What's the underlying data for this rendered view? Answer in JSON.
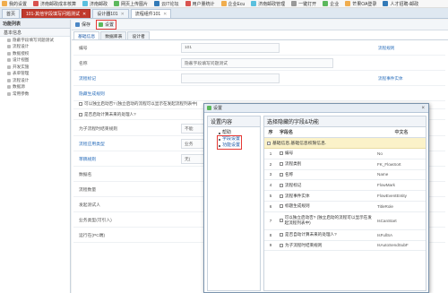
{
  "bookmarks": [
    "我的设置",
    "济南邮政成本核算",
    "济南邮政",
    "网页上传图片",
    "云IT论坛",
    "用户量统计",
    "企业Ecu",
    "济南邮政管理",
    "一键打开",
    "企业",
    "芒果OA登录",
    "人才招聘-邮政"
  ],
  "tabs": [
    {
      "label": "首页"
    },
    {
      "label": "101-其他字段填写问题测试"
    },
    {
      "label": "设计器101"
    },
    {
      "label": "流程组件101"
    }
  ],
  "sidebar": {
    "header": "功能列表",
    "group": "基本信息",
    "items": [
      "隐蔽字段填写问题测试",
      "流程设计",
      "数据授权",
      "设计视图",
      "开发实施",
      "表单管理",
      "流程设计",
      "数据源",
      "常用参数"
    ]
  },
  "toolbar": {
    "save_label": "保存",
    "settings_label": "设置"
  },
  "subtabs": [
    "基础信息",
    "数据库表",
    "设计者"
  ],
  "form": {
    "rows": [
      {
        "label": "编号",
        "value": "101",
        "link": "流程规则"
      },
      {
        "label": "名称",
        "value": "隐蔽字段填写问题测试",
        "link": ""
      },
      {
        "label": "流程标记",
        "value": "",
        "link": "流程事件实体"
      },
      {
        "label": "隐藏生成规则",
        "value": "",
        "link": ""
      },
      {
        "label": "可以独立启动否? (独立启动的流程可以显示在发起流程列表中)",
        "value": "",
        "link": ""
      },
      {
        "label": "是否启动计算未来的处理人?",
        "value": "",
        "link": ""
      },
      {
        "label": "为子流程时结束规则",
        "value": "不能",
        "link": ""
      },
      {
        "label": "流程应用类型",
        "value": "业务",
        "link": ""
      },
      {
        "label": "草稿规则",
        "value": "无(",
        "link": ""
      },
      {
        "label": "数据名",
        "value": "",
        "link": ""
      },
      {
        "label": "流程数量",
        "value": "",
        "link": ""
      },
      {
        "label": "发起测试人",
        "value": "",
        "link": ""
      },
      {
        "label": "业务类型(可引入)",
        "value": "",
        "link": ""
      },
      {
        "label": "运行在(PC端)",
        "value": "",
        "link": ""
      }
    ]
  },
  "dialog": {
    "title": "设置",
    "left_header": "设置内容",
    "tree": [
      "帮助",
      "字段设置",
      "功能设置"
    ],
    "right_header": "选择隐藏的字段&功能",
    "col_no": "序",
    "col_name": "字段名",
    "col_cn": "中文名",
    "note": "基础信息,基础信息权限信息.",
    "rows": [
      {
        "no": "1",
        "name": "编号",
        "cn": "No"
      },
      {
        "no": "2",
        "name": "流程类别",
        "cn": "FK_FlowSort"
      },
      {
        "no": "3",
        "name": "名称",
        "cn": "Name"
      },
      {
        "no": "4",
        "name": "流程标记",
        "cn": "FlowMark"
      },
      {
        "no": "5",
        "name": "流程事件实体",
        "cn": "FlowEventEntity"
      },
      {
        "no": "6",
        "name": "标题生成规则",
        "cn": "TitleRole"
      },
      {
        "no": "7",
        "name": "可以独立启动否? (独立启动的流程可以显示在发起流程列表中)",
        "cn": "IsCanStart"
      },
      {
        "no": "8",
        "name": "是否自动计算未来的处理人?",
        "cn": "IsFullSA"
      },
      {
        "no": "9",
        "name": "为子流程时结束规则",
        "cn": "IsAutoSendSubF"
      }
    ]
  },
  "colors": {
    "accent": "#1e5aa8",
    "highlight_box": "#e53935",
    "note_bg": "#fbf2c9"
  }
}
